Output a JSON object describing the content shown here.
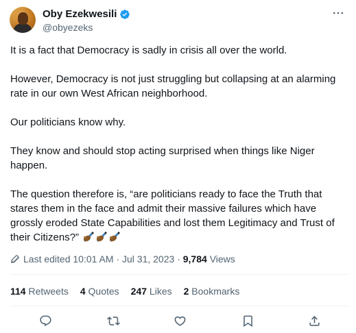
{
  "author": {
    "display_name": "Oby Ezekwesili",
    "handle": "@obyezeks",
    "verified_icon": "verified-badge-icon",
    "avatar_icon": "profile-avatar"
  },
  "menu": {
    "more_icon": "more-horizontal-icon"
  },
  "text": {
    "p1": "It is a fact that Democracy is sadly in crisis all over the world.",
    "p2": "However, Democracy is not just struggling but collapsing at an alarming rate in our own West African neighborhood.",
    "p3": "Our politicians know why.",
    "p4": "They know and should stop acting surprised when things like Niger happen.",
    "p5": "The question therefore is, “are politicians ready to face the Truth that stares them in the face and admit their massive failures which have grossly eroded State Capabilities and lost them Legitimacy and Trust of their Citizens?”",
    "emoji_icon": "writing-hand-emoji"
  },
  "meta": {
    "edited_label": "Last edited",
    "time": "10:01 AM",
    "separator": "·",
    "date": "Jul 31, 2023",
    "views_count": "9,784",
    "views_label": "Views",
    "pencil_icon": "pencil-icon"
  },
  "stats": {
    "retweets_count": "114",
    "retweets_label": "Retweets",
    "quotes_count": "4",
    "quotes_label": "Quotes",
    "likes_count": "247",
    "likes_label": "Likes",
    "bookmarks_count": "2",
    "bookmarks_label": "Bookmarks"
  },
  "actions": {
    "reply_icon": "reply-icon",
    "retweet_icon": "retweet-icon",
    "like_icon": "like-heart-icon",
    "bookmark_icon": "bookmark-icon",
    "share_icon": "share-icon"
  },
  "colors": {
    "text_primary": "#0f1419",
    "text_secondary": "#536471",
    "verified_blue": "#1d9bf0",
    "divider": "#eff3f4"
  }
}
